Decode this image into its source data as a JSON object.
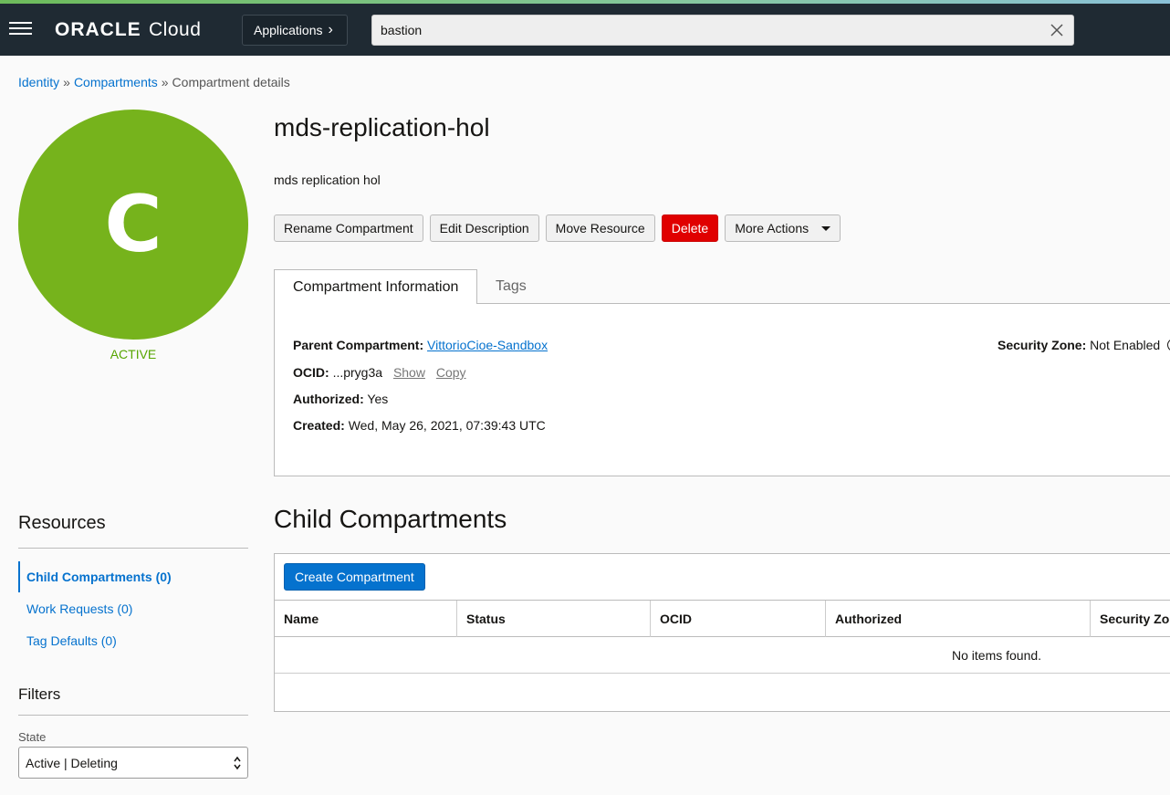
{
  "header": {
    "logo_brand": "ORACLE",
    "logo_product": "Cloud",
    "applications_label": "Applications",
    "search_value": "bastion",
    "accent_color": "#1f2a33"
  },
  "breadcrumb": {
    "items": [
      "Identity",
      "Compartments",
      "Compartment details"
    ],
    "separator": "»"
  },
  "compartment": {
    "avatar_letter": "C",
    "avatar_color": "#76b31c",
    "status": "ACTIVE",
    "name": "mds-replication-hol",
    "description": "mds replication hol"
  },
  "actions": {
    "rename": "Rename Compartment",
    "edit_description": "Edit Description",
    "move_resource": "Move Resource",
    "delete": "Delete",
    "more_actions": "More Actions"
  },
  "tabs": {
    "info": "Compartment Information",
    "tags": "Tags"
  },
  "info": {
    "parent_label": "Parent Compartment:",
    "parent_value": "VittorioCioe-Sandbox",
    "ocid_label": "OCID:",
    "ocid_value": "...pryg3a",
    "show": "Show",
    "copy": "Copy",
    "authorized_label": "Authorized:",
    "authorized_value": "Yes",
    "created_label": "Created:",
    "created_value": "Wed, May 26, 2021, 07:39:43 UTC",
    "security_zone_label": "Security Zone:",
    "security_zone_value": "Not Enabled"
  },
  "resources": {
    "title": "Resources",
    "items": [
      {
        "label": "Child Compartments (0)",
        "active": true
      },
      {
        "label": "Work Requests (0)",
        "active": false
      },
      {
        "label": "Tag Defaults (0)",
        "active": false
      }
    ]
  },
  "filters": {
    "title": "Filters",
    "state_label": "State",
    "state_value": "Active | Deleting"
  },
  "child_compartments": {
    "title": "Child Compartments",
    "create_button": "Create Compartment",
    "columns": [
      "Name",
      "Status",
      "OCID",
      "Authorized",
      "Security Zo"
    ],
    "empty_message": "No items found."
  }
}
